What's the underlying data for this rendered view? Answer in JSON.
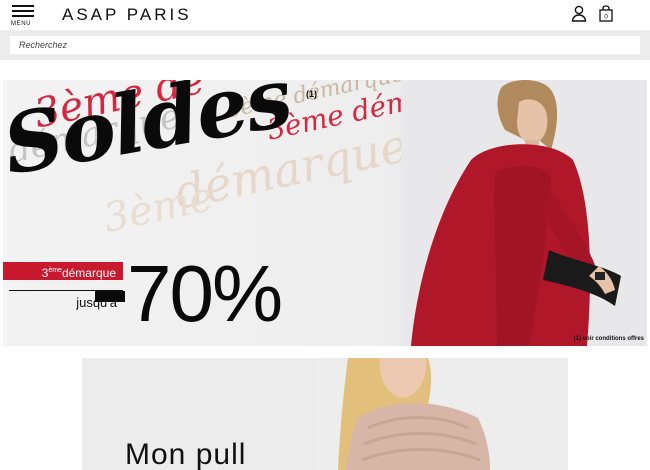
{
  "header": {
    "menu_label": "MENU",
    "brand": "ASAP PARIS",
    "bag_count": "0"
  },
  "search": {
    "placeholder": "Recherchez"
  },
  "banner": {
    "title": "Soldes",
    "title_note": "(1)",
    "background_script": [
      "3ème de",
      "démarque",
      "3ème démarque",
      "3ème démarque",
      "démarque",
      "3ème"
    ],
    "tag_prefix": "3",
    "tag_sup": "ème",
    "tag_word": "démarque",
    "upto": "jusqu'à",
    "discount": "70%",
    "conditions": "(1) voir conditions offres",
    "colors": {
      "accent": "#c8192e",
      "text": "#0a0a0a",
      "coat": "#b0182a"
    }
  },
  "promo": {
    "title": "Mon pull"
  }
}
